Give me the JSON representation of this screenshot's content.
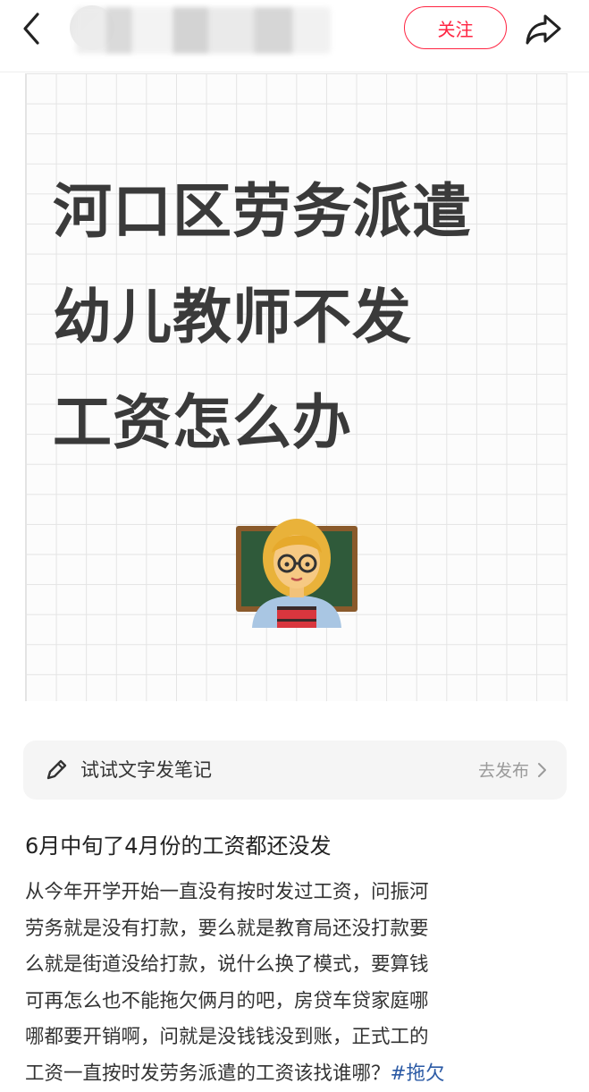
{
  "header": {
    "follow_label": "关注"
  },
  "cover": {
    "title_lines": [
      "河口区劳务派遣",
      "幼儿教师不发",
      "工资怎么办"
    ],
    "emoji": "teacher-emoji"
  },
  "compose": {
    "prompt": "试试文字发笔记",
    "publish_label": "去发布"
  },
  "post": {
    "title": "6月中旬了4月份的工资都还没发",
    "body_lines": [
      "从今年开学开始一直没有按时发过工资，问振河",
      "劳务就是没有打款，要么就是教育局还没打款要",
      "么就是街道没给打款，说什么换了模式，要算钱",
      "可再怎么也不能拖欠俩月的吧，房贷车贷家庭哪",
      "哪都要开销啊，问就是没钱钱没到账，正式工的",
      "工资一直按时发劳务派遣的工资该找谁哪？"
    ],
    "hashtag_partial": "#拖欠"
  },
  "colors": {
    "accent": "#ff2442",
    "hashtag": "#2b5aa5",
    "cover_text": "#3a3a3a"
  }
}
